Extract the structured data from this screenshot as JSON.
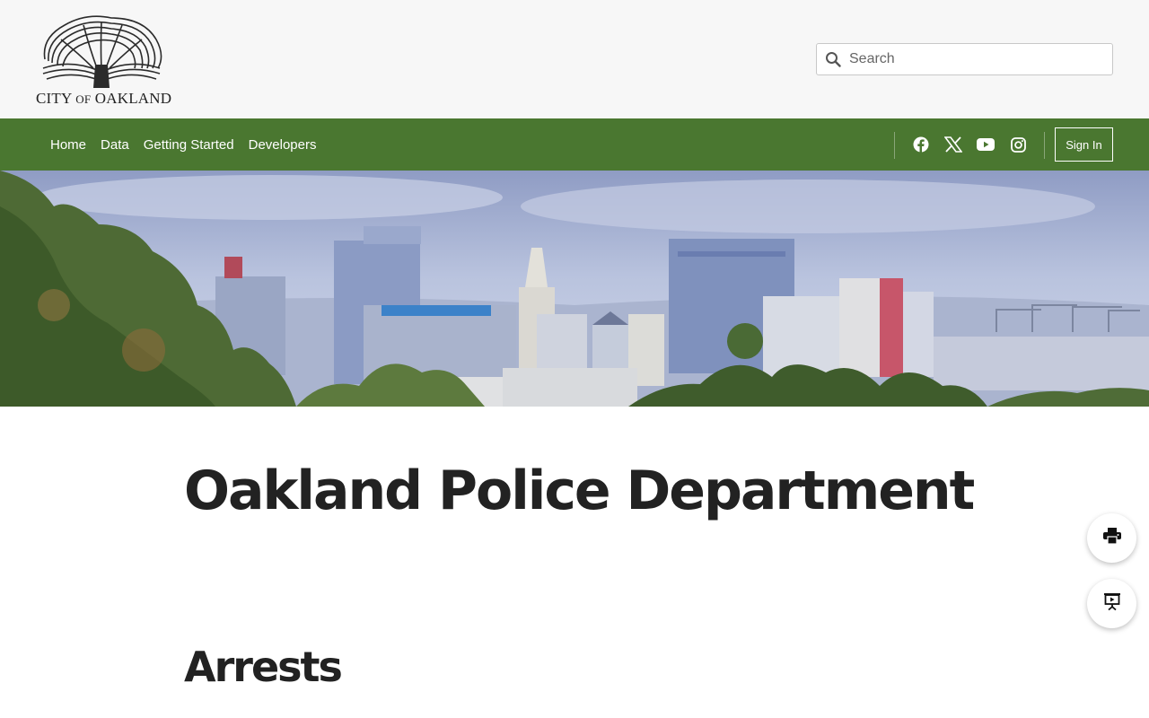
{
  "header": {
    "logo_text_1": "CITY",
    "logo_text_2": "OF",
    "logo_text_3": "OAKLAND",
    "search_placeholder": "Search"
  },
  "nav": {
    "links": [
      "Home",
      "Data",
      "Getting Started",
      "Developers"
    ],
    "social_icons": [
      "facebook-icon",
      "x-icon",
      "youtube-icon",
      "instagram-icon"
    ],
    "signin_label": "Sign In"
  },
  "colors": {
    "nav_bg": "#4a7730",
    "header_bg": "#f7f7f7",
    "title_text": "#222222"
  },
  "content": {
    "page_title": "Oakland Police Department",
    "section_title": "Arrests"
  },
  "fabs": [
    "print-icon",
    "present-icon"
  ]
}
